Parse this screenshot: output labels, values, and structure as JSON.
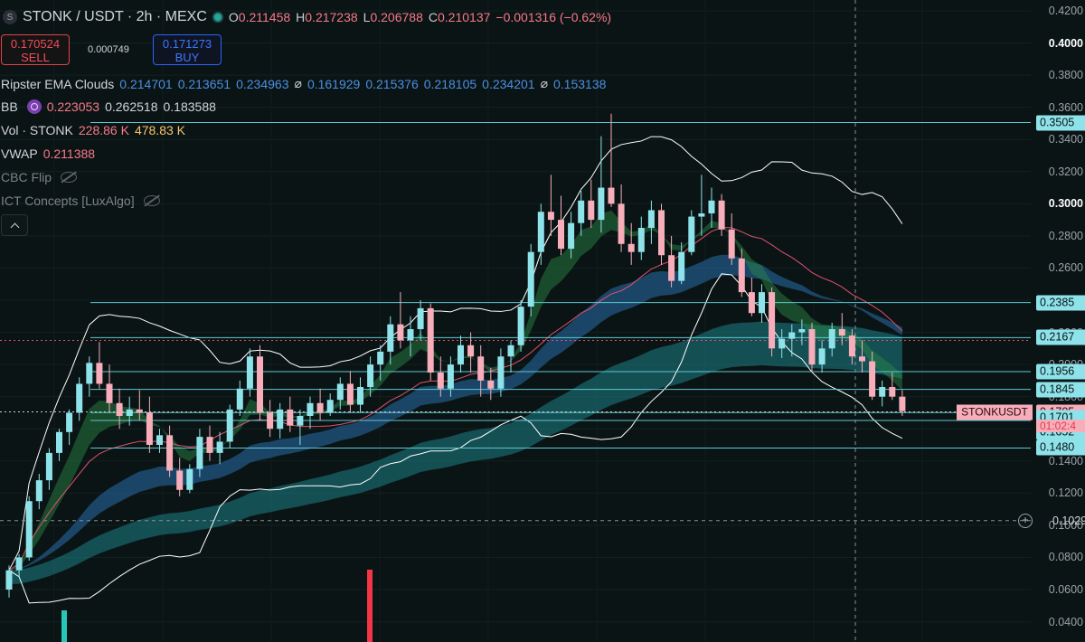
{
  "header": {
    "symbol_icon": "S",
    "title": "STONK / USDT · 2h · MEXC",
    "ohlc": {
      "o_label": "O",
      "o": "0.211458",
      "h_label": "H",
      "h": "0.217238",
      "l_label": "L",
      "l": "0.206788",
      "c_label": "C",
      "c": "0.210137",
      "change": "−0.001316 (−0.62%)"
    }
  },
  "trade": {
    "sell_price": "0.170524",
    "sell_label": "SELL",
    "spread": "0.000749",
    "buy_price": "0.171273",
    "buy_label": "BUY"
  },
  "indicators": {
    "ripster": {
      "name": "Ripster EMA Clouds",
      "values": [
        "0.214701",
        "0.213651",
        "0.234963",
        "⌀",
        "0.161929",
        "0.215376",
        "0.218105",
        "0.234201",
        "⌀",
        "0.153138"
      ]
    },
    "bb": {
      "name": "BB",
      "v1": "0.223053",
      "v2": "0.262518",
      "v3": "0.183588"
    },
    "vol": {
      "name": "Vol · STONK",
      "v1": "228.86 K",
      "v2": "478.83 K"
    },
    "vwap": {
      "name": "VWAP",
      "v1": "0.211388"
    },
    "cbc": {
      "name": "CBC Flip"
    },
    "ict": {
      "name": "ICT Concepts [LuxAlgo]"
    }
  },
  "axis": {
    "labels": [
      "0.4200",
      "0.4000",
      "0.3800",
      "0.3600",
      "0.3400",
      "0.3200",
      "0.3000",
      "0.2800",
      "0.2600",
      "0.2400",
      "0.2200",
      "0.2000",
      "0.1800",
      "0.1600",
      "0.1400",
      "0.1200",
      "0.1000",
      "0.0800",
      "0.0600",
      "0.0400"
    ],
    "bold_labels": [
      "0.4000",
      "0.3000"
    ],
    "tags": [
      {
        "text": "0.3505",
        "price": 0.3505,
        "style": "teal"
      },
      {
        "text": "0.2385",
        "price": 0.2385,
        "style": "teal"
      },
      {
        "text": "0.2167",
        "price": 0.2167,
        "style": "teal"
      },
      {
        "text": "0.1956",
        "price": 0.1956,
        "style": "teal"
      },
      {
        "text": "0.1845",
        "price": 0.1845,
        "style": "teal"
      },
      {
        "text": "0.1705",
        "price": 0.1705,
        "style": "pink"
      },
      {
        "text": "0.1701",
        "price": 0.1669,
        "style": "teal"
      },
      {
        "text": "0.1652",
        "price": 0.1576,
        "style": "teal"
      },
      {
        "text": "0.1480",
        "price": 0.1484,
        "style": "teal"
      }
    ],
    "symbol_tag": "STONKUSDT",
    "countdown": "01:02:4",
    "crosshair_price": "0.1029",
    "colors": {
      "teal_tag": "#8ee3ea",
      "pink_tag": "#f7aeba",
      "up": "#8ee3ea",
      "down": "#f7aeba",
      "bb": "#ffffff"
    }
  },
  "chart_data": {
    "type": "candlestick",
    "title": "STONK / USDT · 2h · MEXC",
    "ylim": [
      0.035,
      0.42
    ],
    "horizontal_levels": [
      0.3505,
      0.2385,
      0.2167,
      0.1956,
      0.1845,
      0.1701,
      0.1652,
      0.148
    ],
    "last_price": 0.1705,
    "candles": [
      [
        0.06,
        0.075,
        0.055,
        0.072
      ],
      [
        0.072,
        0.082,
        0.068,
        0.08
      ],
      [
        0.08,
        0.118,
        0.078,
        0.115
      ],
      [
        0.115,
        0.132,
        0.11,
        0.128
      ],
      [
        0.128,
        0.148,
        0.122,
        0.145
      ],
      [
        0.145,
        0.16,
        0.14,
        0.158
      ],
      [
        0.158,
        0.172,
        0.15,
        0.17
      ],
      [
        0.17,
        0.192,
        0.165,
        0.188
      ],
      [
        0.188,
        0.205,
        0.18,
        0.201
      ],
      [
        0.201,
        0.214,
        0.185,
        0.188
      ],
      [
        0.188,
        0.2,
        0.17,
        0.176
      ],
      [
        0.176,
        0.185,
        0.16,
        0.168
      ],
      [
        0.168,
        0.18,
        0.162,
        0.172
      ],
      [
        0.172,
        0.184,
        0.165,
        0.17
      ],
      [
        0.17,
        0.18,
        0.145,
        0.15
      ],
      [
        0.15,
        0.16,
        0.145,
        0.156
      ],
      [
        0.156,
        0.162,
        0.13,
        0.134
      ],
      [
        0.134,
        0.142,
        0.118,
        0.122
      ],
      [
        0.122,
        0.138,
        0.12,
        0.135
      ],
      [
        0.135,
        0.16,
        0.13,
        0.155
      ],
      [
        0.155,
        0.162,
        0.14,
        0.145
      ],
      [
        0.145,
        0.158,
        0.138,
        0.152
      ],
      [
        0.152,
        0.175,
        0.148,
        0.172
      ],
      [
        0.172,
        0.19,
        0.168,
        0.185
      ],
      [
        0.185,
        0.21,
        0.18,
        0.205
      ],
      [
        0.205,
        0.212,
        0.165,
        0.17
      ],
      [
        0.17,
        0.178,
        0.155,
        0.16
      ],
      [
        0.16,
        0.176,
        0.154,
        0.172
      ],
      [
        0.172,
        0.18,
        0.158,
        0.162
      ],
      [
        0.162,
        0.172,
        0.15,
        0.168
      ],
      [
        0.168,
        0.18,
        0.16,
        0.176
      ],
      [
        0.176,
        0.185,
        0.165,
        0.17
      ],
      [
        0.17,
        0.182,
        0.168,
        0.178
      ],
      [
        0.178,
        0.192,
        0.172,
        0.188
      ],
      [
        0.188,
        0.196,
        0.17,
        0.175
      ],
      [
        0.175,
        0.192,
        0.17,
        0.186
      ],
      [
        0.186,
        0.205,
        0.18,
        0.2
      ],
      [
        0.2,
        0.212,
        0.19,
        0.208
      ],
      [
        0.208,
        0.23,
        0.2,
        0.225
      ],
      [
        0.225,
        0.245,
        0.21,
        0.215
      ],
      [
        0.215,
        0.23,
        0.205,
        0.222
      ],
      [
        0.222,
        0.24,
        0.215,
        0.235
      ],
      [
        0.235,
        0.238,
        0.19,
        0.195
      ],
      [
        0.195,
        0.205,
        0.18,
        0.185
      ],
      [
        0.185,
        0.205,
        0.18,
        0.2
      ],
      [
        0.2,
        0.218,
        0.195,
        0.212
      ],
      [
        0.212,
        0.22,
        0.195,
        0.205
      ],
      [
        0.205,
        0.212,
        0.18,
        0.19
      ],
      [
        0.19,
        0.198,
        0.178,
        0.185
      ],
      [
        0.185,
        0.21,
        0.18,
        0.205
      ],
      [
        0.205,
        0.215,
        0.195,
        0.212
      ],
      [
        0.212,
        0.24,
        0.208,
        0.236
      ],
      [
        0.236,
        0.275,
        0.23,
        0.27
      ],
      [
        0.27,
        0.3,
        0.262,
        0.295
      ],
      [
        0.295,
        0.318,
        0.28,
        0.29
      ],
      [
        0.29,
        0.305,
        0.268,
        0.272
      ],
      [
        0.272,
        0.295,
        0.266,
        0.288
      ],
      [
        0.288,
        0.308,
        0.28,
        0.302
      ],
      [
        0.302,
        0.315,
        0.285,
        0.29
      ],
      [
        0.29,
        0.342,
        0.282,
        0.31
      ],
      [
        0.31,
        0.356,
        0.298,
        0.3
      ],
      [
        0.3,
        0.312,
        0.27,
        0.275
      ],
      [
        0.275,
        0.288,
        0.262,
        0.27
      ],
      [
        0.27,
        0.292,
        0.265,
        0.285
      ],
      [
        0.285,
        0.302,
        0.275,
        0.296
      ],
      [
        0.296,
        0.3,
        0.262,
        0.268
      ],
      [
        0.268,
        0.28,
        0.248,
        0.252
      ],
      [
        0.252,
        0.276,
        0.25,
        0.27
      ],
      [
        0.27,
        0.296,
        0.268,
        0.292
      ],
      [
        0.292,
        0.318,
        0.28,
        0.294
      ],
      [
        0.294,
        0.31,
        0.285,
        0.302
      ],
      [
        0.302,
        0.306,
        0.28,
        0.284
      ],
      [
        0.284,
        0.294,
        0.262,
        0.266
      ],
      [
        0.266,
        0.272,
        0.242,
        0.245
      ],
      [
        0.245,
        0.254,
        0.23,
        0.232
      ],
      [
        0.232,
        0.25,
        0.226,
        0.245
      ],
      [
        0.245,
        0.248,
        0.205,
        0.21
      ],
      [
        0.21,
        0.222,
        0.204,
        0.216
      ],
      [
        0.216,
        0.225,
        0.205,
        0.22
      ],
      [
        0.22,
        0.228,
        0.212,
        0.222
      ],
      [
        0.222,
        0.226,
        0.195,
        0.2
      ],
      [
        0.2,
        0.215,
        0.195,
        0.21
      ],
      [
        0.21,
        0.226,
        0.205,
        0.222
      ],
      [
        0.222,
        0.232,
        0.212,
        0.218
      ],
      [
        0.218,
        0.222,
        0.2,
        0.205
      ],
      [
        0.205,
        0.215,
        0.195,
        0.202
      ],
      [
        0.202,
        0.208,
        0.178,
        0.18
      ],
      [
        0.18,
        0.19,
        0.174,
        0.186
      ],
      [
        0.186,
        0.195,
        0.178,
        0.18
      ],
      [
        0.18,
        0.184,
        0.168,
        0.171
      ]
    ]
  }
}
